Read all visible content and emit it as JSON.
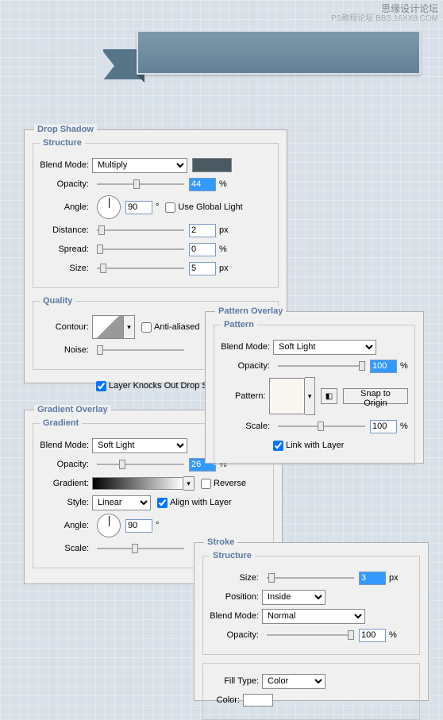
{
  "watermark": {
    "line1": "思缘设计论坛",
    "line2": "PS教程论坛  BBS.16XX8.COM"
  },
  "drop_shadow": {
    "title": "Drop Shadow",
    "structure_label": "Structure",
    "blend_mode_label": "Blend Mode:",
    "blend_mode_value": "Multiply",
    "swatch_color": "#4b5963",
    "opacity_label": "Opacity:",
    "opacity_value": "44",
    "opacity_unit": "%",
    "angle_label": "Angle:",
    "angle_value": "90",
    "angle_unit": "°",
    "use_global_light": "Use Global Light",
    "distance_label": "Distance:",
    "distance_value": "2",
    "distance_unit": "px",
    "spread_label": "Spread:",
    "spread_value": "0",
    "spread_unit": "%",
    "size_label": "Size:",
    "size_value": "5",
    "size_unit": "px",
    "quality_label": "Quality",
    "contour_label": "Contour:",
    "anti_aliased": "Anti-aliased",
    "noise_label": "Noise:",
    "knocks_out": "Layer Knocks Out Drop Shadow"
  },
  "pattern_overlay": {
    "title": "Pattern Overlay",
    "pattern_label": "Pattern",
    "blend_mode_label": "Blend Mode:",
    "blend_mode_value": "Soft Light",
    "opacity_label": "Opacity:",
    "opacity_value": "100",
    "opacity_unit": "%",
    "pattern_field_label": "Pattern:",
    "snap_to_origin": "Snap to Origin",
    "scale_label": "Scale:",
    "scale_value": "100",
    "scale_unit": "%",
    "link_with_layer": "Link with Layer"
  },
  "gradient_overlay": {
    "title": "Gradient Overlay",
    "gradient_label": "Gradient",
    "blend_mode_label": "Blend Mode:",
    "blend_mode_value": "Soft Light",
    "opacity_label": "Opacity:",
    "opacity_value": "26",
    "opacity_unit": "%",
    "gradient_field_label": "Gradient:",
    "reverse": "Reverse",
    "style_label": "Style:",
    "style_value": "Linear",
    "align_with_layer": "Align with Layer",
    "angle_label": "Angle:",
    "angle_value": "90",
    "angle_unit": "°",
    "scale_label": "Scale:"
  },
  "stroke": {
    "title": "Stroke",
    "structure_label": "Structure",
    "size_label": "Size:",
    "size_value": "3",
    "size_unit": "px",
    "position_label": "Position:",
    "position_value": "Inside",
    "blend_mode_label": "Blend Mode:",
    "blend_mode_value": "Normal",
    "opacity_label": "Opacity:",
    "opacity_value": "100",
    "opacity_unit": "%",
    "fill_type_label": "Fill Type:",
    "fill_type_value": "Color",
    "color_label": "Color:",
    "color_value": "#ffffff"
  }
}
